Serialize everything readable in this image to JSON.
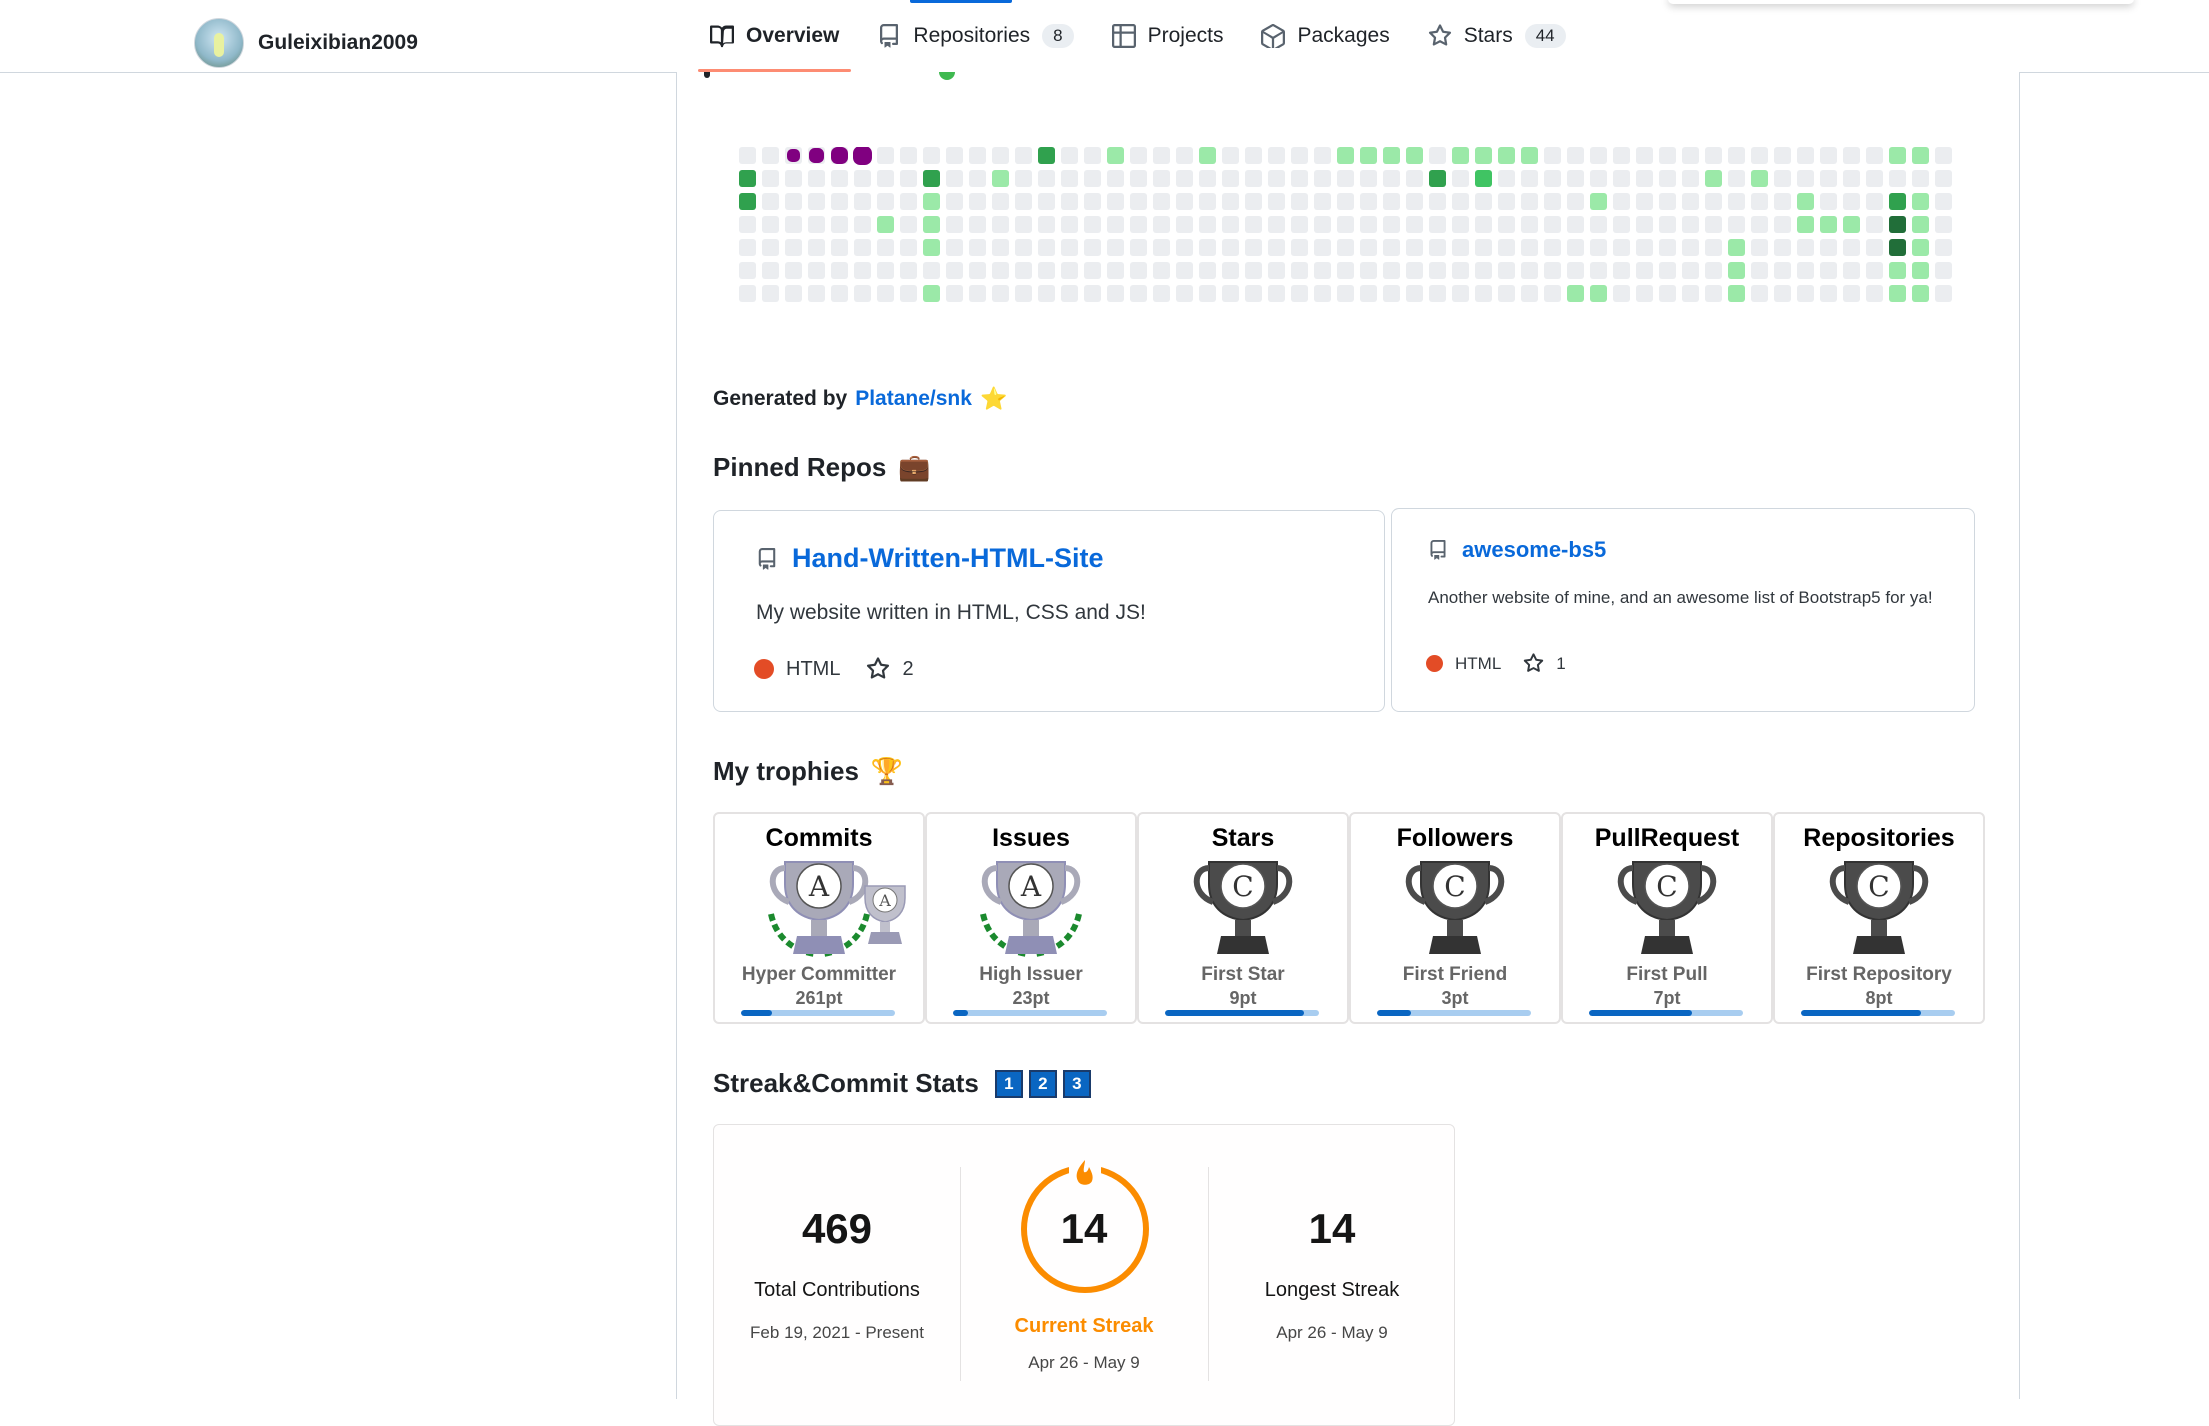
{
  "header": {
    "username": "Guleixibian2009",
    "tabs": [
      {
        "label": "Overview",
        "icon": "book-icon",
        "active": true
      },
      {
        "label": "Repositories",
        "icon": "repo-icon",
        "count": "8"
      },
      {
        "label": "Projects",
        "icon": "table-icon"
      },
      {
        "label": "Packages",
        "icon": "package-icon"
      },
      {
        "label": "Stars",
        "icon": "star-icon",
        "count": "44"
      }
    ]
  },
  "colors": {
    "snake": "#800080",
    "level1": "#9be9a8",
    "level2": "#40c463",
    "level3": "#30a14e",
    "level4": "#216e39",
    "empty": "#ebedf0",
    "html_lang": "#e34c26",
    "link": "#0969da",
    "streak_orange": "#fb8c00"
  },
  "contribution_grid": {
    "weeks": 53,
    "days": 7,
    "cells": [
      "0000000000000300100010000011110111100000000000000011",
      "3000000030010000000000000000003020000000001010000000",
      "3000000010000000000000000000000000000100000000100031",
      "0000001010000000000000000000000000000000000000111041",
      "0000000010000000000000000000000000000000000100000041",
      "0000000000000000000000000000000000000000000100000011",
      "0000000010000000000000000000000000001100000100000011"
    ],
    "snake_cells": [
      [
        0,
        2
      ],
      [
        0,
        3
      ],
      [
        0,
        4
      ],
      [
        0,
        5
      ]
    ]
  },
  "generated": {
    "prefix": "Generated by",
    "link": "Platane/snk",
    "emoji": "⭐"
  },
  "pinned": {
    "title": "Pinned Repos",
    "emoji": "💼",
    "repos": [
      {
        "name": "Hand-Written-HTML-Site",
        "description": "My website written in HTML, CSS and JS!",
        "language": "HTML",
        "stars": "2"
      },
      {
        "name": "awesome-bs5",
        "description": "Another website of mine, and an awesome list of Bootstrap5 for ya!",
        "language": "HTML",
        "stars": "1"
      }
    ]
  },
  "trophies": {
    "title": "My trophies",
    "emoji": "🏆",
    "items": [
      {
        "category": "Commits",
        "rank": "A",
        "title": "Hyper Committer",
        "points": "261pt",
        "progress": 0.2
      },
      {
        "category": "Issues",
        "rank": "A",
        "title": "High Issuer",
        "points": "23pt",
        "progress": 0.1
      },
      {
        "category": "Stars",
        "rank": "C",
        "title": "First Star",
        "points": "9pt",
        "progress": 0.9
      },
      {
        "category": "Followers",
        "rank": "C",
        "title": "First Friend",
        "points": "3pt",
        "progress": 0.22
      },
      {
        "category": "PullRequest",
        "rank": "C",
        "title": "First Pull",
        "points": "7pt",
        "progress": 0.67
      },
      {
        "category": "Repositories",
        "rank": "C",
        "title": "First Repository",
        "points": "8pt",
        "progress": 0.78
      }
    ]
  },
  "streak": {
    "title": "Streak&Commit Stats",
    "badges": [
      "1",
      "2",
      "3"
    ],
    "total": {
      "value": "469",
      "label": "Total Contributions",
      "range": "Feb 19, 2021 - Present"
    },
    "current": {
      "value": "14",
      "label": "Current Streak",
      "range": "Apr 26 - May 9"
    },
    "longest": {
      "value": "14",
      "label": "Longest Streak",
      "range": "Apr 26 - May 9"
    }
  }
}
